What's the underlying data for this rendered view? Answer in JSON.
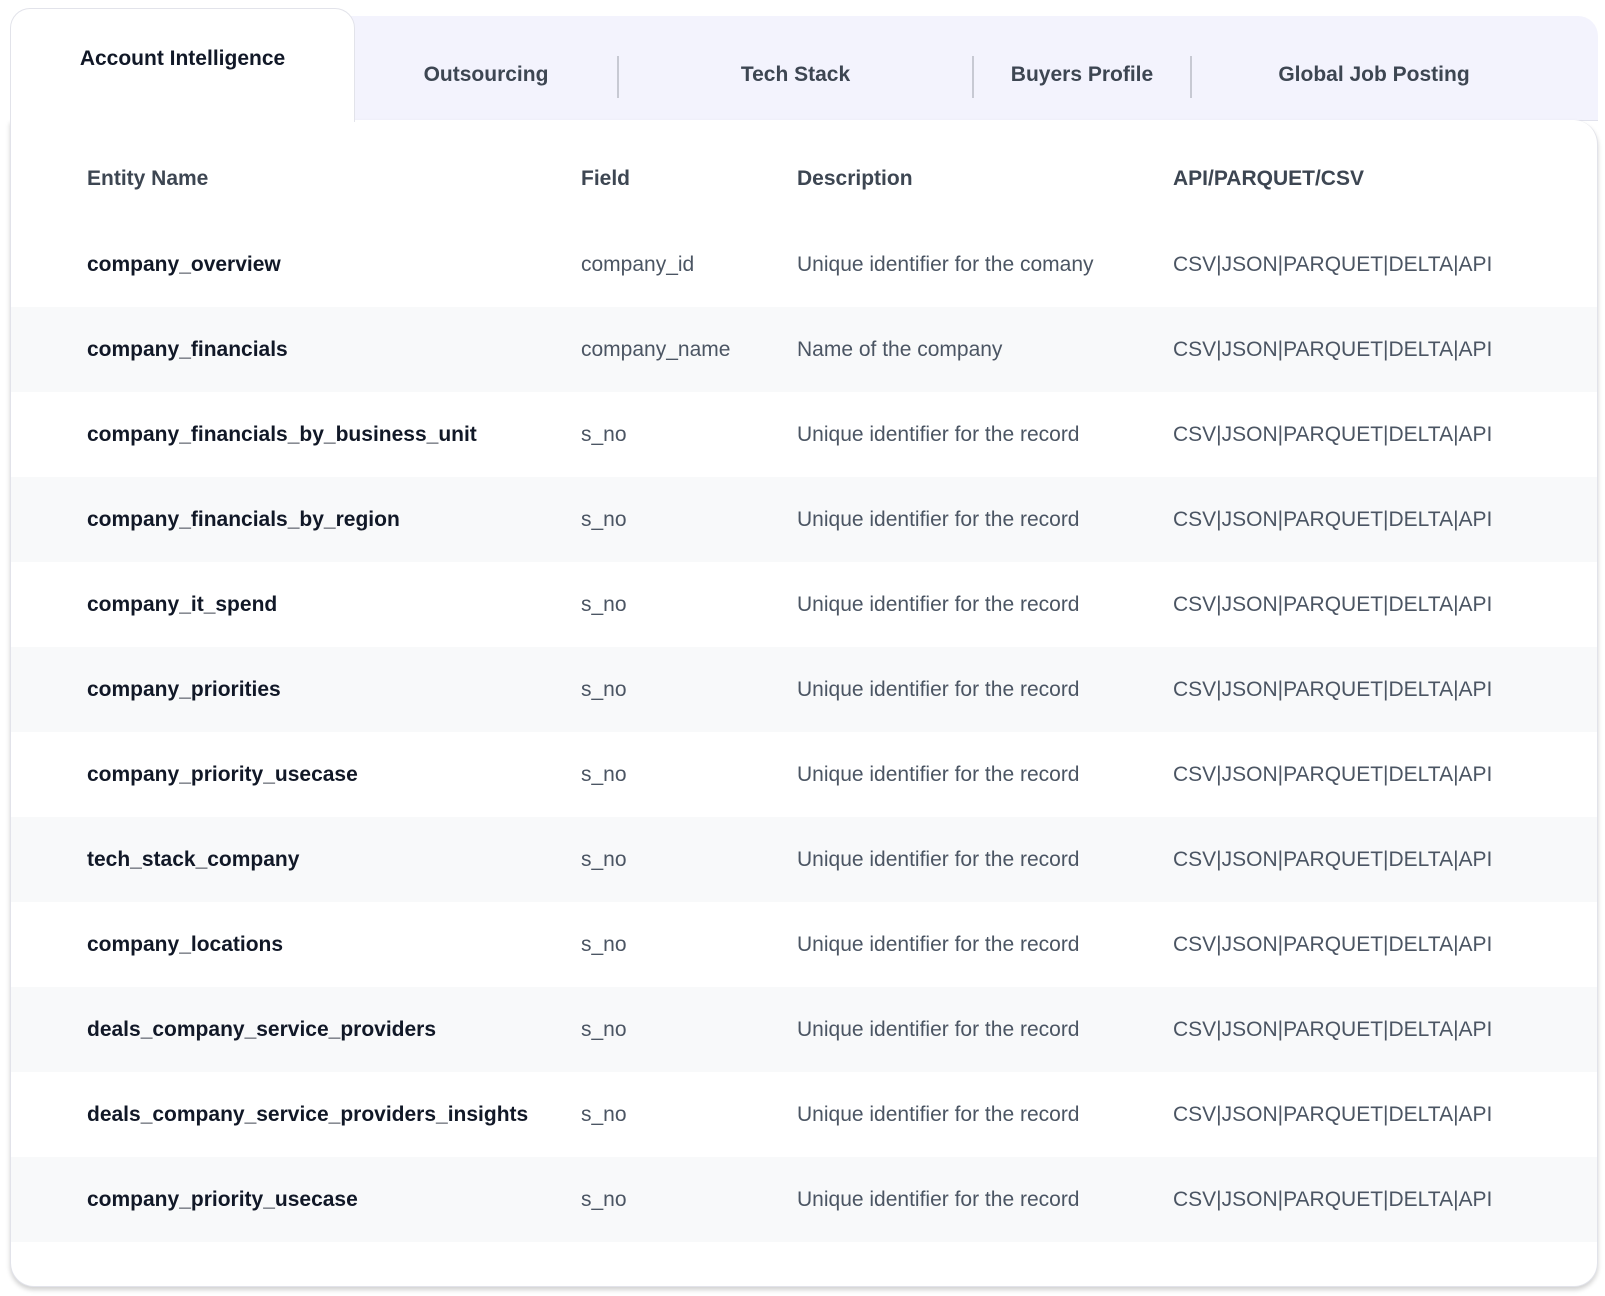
{
  "tabs": [
    {
      "label": "Account Intelligence",
      "active": true
    },
    {
      "label": "Outsourcing",
      "active": false
    },
    {
      "label": "Tech Stack",
      "active": false
    },
    {
      "label": "Buyers Profile",
      "active": false
    },
    {
      "label": "Global Job Posting",
      "active": false
    }
  ],
  "table": {
    "columns": [
      "Entity Name",
      "Field",
      "Description",
      "API/PARQUET/CSV"
    ],
    "rows": [
      {
        "entity": "company_overview",
        "field": "company_id",
        "description": "Unique identifier for the comany",
        "format": "CSV|JSON|PARQUET|DELTA|API"
      },
      {
        "entity": "company_financials",
        "field": "company_name",
        "description": "Name of the company",
        "format": "CSV|JSON|PARQUET|DELTA|API"
      },
      {
        "entity": "company_financials_by_business_unit",
        "field": "s_no",
        "description": "Unique identifier for the record",
        "format": "CSV|JSON|PARQUET|DELTA|API"
      },
      {
        "entity": "company_financials_by_region",
        "field": "s_no",
        "description": "Unique identifier for the record",
        "format": "CSV|JSON|PARQUET|DELTA|API"
      },
      {
        "entity": "company_it_spend",
        "field": "s_no",
        "description": "Unique identifier for the record",
        "format": "CSV|JSON|PARQUET|DELTA|API"
      },
      {
        "entity": "company_priorities",
        "field": "s_no",
        "description": "Unique identifier for the record",
        "format": "CSV|JSON|PARQUET|DELTA|API"
      },
      {
        "entity": "company_priority_usecase",
        "field": "s_no",
        "description": "Unique identifier for the record",
        "format": "CSV|JSON|PARQUET|DELTA|API"
      },
      {
        "entity": "tech_stack_company",
        "field": "s_no",
        "description": "Unique identifier for the record",
        "format": "CSV|JSON|PARQUET|DELTA|API"
      },
      {
        "entity": "company_locations",
        "field": "s_no",
        "description": "Unique identifier for the record",
        "format": "CSV|JSON|PARQUET|DELTA|API"
      },
      {
        "entity": "deals_company_service_providers",
        "field": "s_no",
        "description": "Unique identifier for the record",
        "format": "CSV|JSON|PARQUET|DELTA|API"
      },
      {
        "entity": "deals_company_service_providers_insights",
        "field": "s_no",
        "description": "Unique identifier for the record",
        "format": "CSV|JSON|PARQUET|DELTA|API"
      },
      {
        "entity": "company_priority_usecase",
        "field": "s_no",
        "description": "Unique identifier for the record",
        "format": "CSV|JSON|PARQUET|DELTA|API"
      }
    ]
  },
  "colors": {
    "tab_strip_bg": "#f3f3fd",
    "stripe_bg": "#f8f9fa",
    "text_strong": "#111827",
    "text_muted": "#4b5563",
    "separator": "#c7c9d3"
  }
}
